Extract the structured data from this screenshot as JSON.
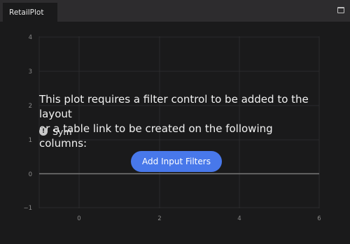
{
  "tab": {
    "title": "RetailPlot"
  },
  "plot": {
    "x_ticks": [
      "0",
      "2",
      "4",
      "6"
    ],
    "y_ticks": [
      "4",
      "3",
      "2",
      "1",
      "0",
      "−1"
    ]
  },
  "message": {
    "line1": "This plot requires a filter control to be added to the layout",
    "line2": "or a table link to be created on the following columns:"
  },
  "columns": [
    {
      "name": "Sym",
      "icon": "warning-icon"
    }
  ],
  "button": {
    "label": "Add Input Filters"
  },
  "colors": {
    "accent": "#4878ea",
    "background": "#1a1a1b"
  }
}
